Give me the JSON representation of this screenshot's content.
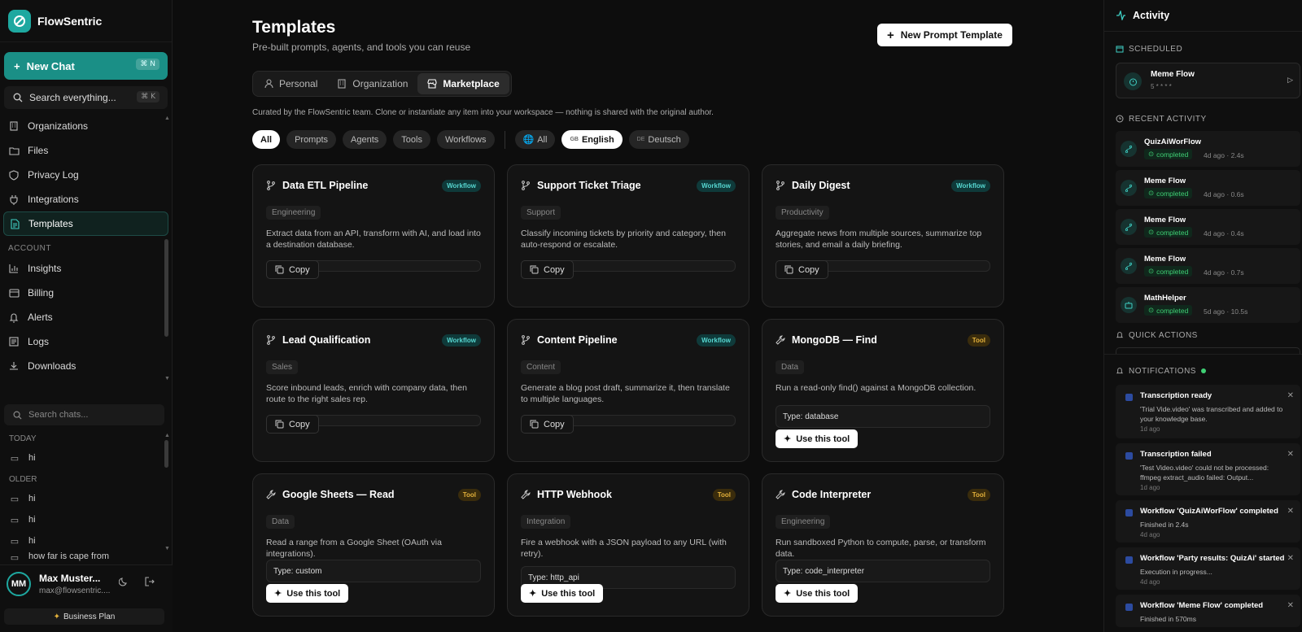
{
  "brand": {
    "name": "FlowSentric"
  },
  "sidebar": {
    "new_chat": "New Chat",
    "new_chat_kbd": "⌘ N",
    "search_label": "Search everything...",
    "search_kbd": "⌘ K",
    "items": [
      {
        "label": "Organizations",
        "icon": "building-icon"
      },
      {
        "label": "Files",
        "icon": "folder-icon"
      },
      {
        "label": "Privacy Log",
        "icon": "shield-icon"
      },
      {
        "label": "Integrations",
        "icon": "plug-icon"
      },
      {
        "label": "Templates",
        "icon": "file-text-icon",
        "active": true
      }
    ],
    "account_section": "ACCOUNT",
    "account_items": [
      {
        "label": "Insights",
        "icon": "bar-chart-icon"
      },
      {
        "label": "Billing",
        "icon": "credit-card-icon"
      },
      {
        "label": "Alerts",
        "icon": "bell-icon"
      },
      {
        "label": "Logs",
        "icon": "list-icon"
      },
      {
        "label": "Downloads",
        "icon": "download-icon"
      }
    ],
    "chat_search_placeholder": "Search chats...",
    "today_label": "TODAY",
    "older_label": "OLDER",
    "today_chats": [
      "hi"
    ],
    "older_chats": [
      "hi",
      "hi",
      "hi",
      "how far is cape from"
    ],
    "user": {
      "initials": "MM",
      "name": "Max Muster...",
      "email": "max@flowsentric....",
      "plan": "Business Plan"
    }
  },
  "main": {
    "title": "Templates",
    "subtitle": "Pre-built prompts, agents, and tools you can reuse",
    "new_button": "New Prompt Template",
    "tabs": [
      {
        "label": "Personal",
        "icon": "user-icon"
      },
      {
        "label": "Organization",
        "icon": "building-icon"
      },
      {
        "label": "Marketplace",
        "icon": "store-icon",
        "active": true
      }
    ],
    "curated_note": "Curated by the FlowSentric team. Clone or instantiate any item into your workspace — nothing is shared with the original author.",
    "type_filters": [
      "All",
      "Prompts",
      "Agents",
      "Tools",
      "Workflows"
    ],
    "lang_filters": [
      {
        "label": "All",
        "tag": "globe"
      },
      {
        "label": "English",
        "tag": "GB"
      },
      {
        "label": "Deutsch",
        "tag": "DE"
      }
    ],
    "copy_label": "Copy",
    "use_tool_label": "Use this tool",
    "cards": [
      {
        "title": "Data ETL Pipeline",
        "badge": "Workflow",
        "kind": "workflow",
        "category": "Engineering",
        "description": "Extract data from an API, transform with AI, and load into a destination database."
      },
      {
        "title": "Support Ticket Triage",
        "badge": "Workflow",
        "kind": "workflow",
        "category": "Support",
        "description": "Classify incoming tickets by priority and category, then auto-respond or escalate."
      },
      {
        "title": "Daily Digest",
        "badge": "Workflow",
        "kind": "workflow",
        "category": "Productivity",
        "description": "Aggregate news from multiple sources, summarize top stories, and email a daily briefing."
      },
      {
        "title": "Lead Qualification",
        "badge": "Workflow",
        "kind": "workflow",
        "category": "Sales",
        "description": "Score inbound leads, enrich with company data, then route to the right sales rep."
      },
      {
        "title": "Content Pipeline",
        "badge": "Workflow",
        "kind": "workflow",
        "category": "Content",
        "description": "Generate a blog post draft, summarize it, then translate to multiple languages."
      },
      {
        "title": "MongoDB — Find",
        "badge": "Tool",
        "kind": "tool",
        "category": "Data",
        "description": "Run a read-only find() against a MongoDB collection.",
        "type": "Type: database"
      },
      {
        "title": "Google Sheets — Read",
        "badge": "Tool",
        "kind": "tool",
        "category": "Data",
        "description": "Read a range from a Google Sheet (OAuth via integrations).",
        "type": "Type: custom"
      },
      {
        "title": "HTTP Webhook",
        "badge": "Tool",
        "kind": "tool",
        "category": "Integration",
        "description": "Fire a webhook with a JSON payload to any URL (with retry).",
        "type": "Type: http_api"
      },
      {
        "title": "Code Interpreter",
        "badge": "Tool",
        "kind": "tool",
        "category": "Engineering",
        "description": "Run sandboxed Python to compute, parse, or transform data.",
        "type": "Type: code_interpreter"
      }
    ]
  },
  "activity": {
    "title": "Activity",
    "scheduled_label": "SCHEDULED",
    "scheduled": {
      "name": "Meme Flow",
      "cron": "5 * * * *"
    },
    "recent_label": "RECENT ACTIVITY",
    "recent": [
      {
        "name": "QuizAiWorFlow",
        "status": "completed",
        "time": "4d ago",
        "duration": "2.4s"
      },
      {
        "name": "Meme Flow",
        "status": "completed",
        "time": "4d ago",
        "duration": "0.6s"
      },
      {
        "name": "Meme Flow",
        "status": "completed",
        "time": "4d ago",
        "duration": "0.4s"
      },
      {
        "name": "Meme Flow",
        "status": "completed",
        "time": "4d ago",
        "duration": "0.7s"
      },
      {
        "name": "MathHelper",
        "status": "completed",
        "time": "5d ago",
        "duration": "10.5s"
      }
    ],
    "quick_actions_label": "QUICK ACTIONS",
    "notifications_label": "NOTIFICATIONS",
    "notifications": [
      {
        "title": "Transcription ready",
        "body": "'Trial Vide.video' was transcribed and added to your knowledge base.",
        "time": "1d ago"
      },
      {
        "title": "Transcription failed",
        "body": "'Test Video.video' could not be processed: ffmpeg extract_audio failed: Output...",
        "time": "1d ago"
      },
      {
        "title": "Workflow 'QuizAiWorFlow' completed",
        "body": "Finished in 2.4s",
        "time": "4d ago"
      },
      {
        "title": "Workflow 'Party results: QuizAi' started",
        "body": "Execution in progress...",
        "time": "4d ago"
      },
      {
        "title": "Workflow 'Meme Flow' completed",
        "body": "Finished in 570ms",
        "time": ""
      }
    ]
  },
  "colors": {
    "accent": "#1a8f86",
    "workflow_badge": "#56d6d0",
    "tool_badge": "#e3b13b",
    "success": "#3fcf74"
  }
}
